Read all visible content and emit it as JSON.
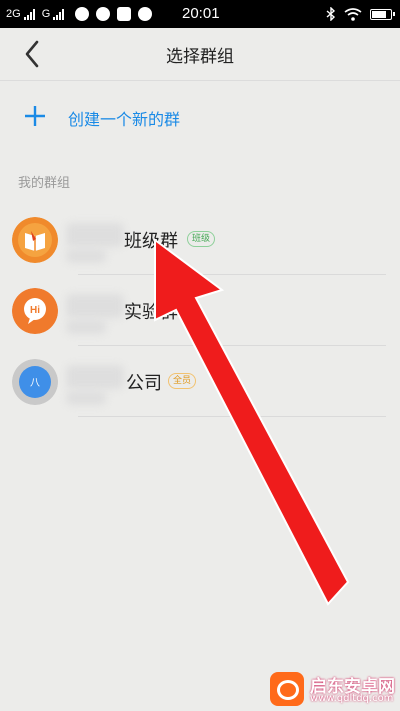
{
  "status_bar": {
    "network_1": "2G",
    "network_2": "G",
    "time": "20:01"
  },
  "nav": {
    "title": "选择群组",
    "back_icon": "chevron-left-icon"
  },
  "create_group": {
    "label": "创建一个新的群",
    "icon": "plus-icon"
  },
  "section": {
    "my_groups": "我的群组"
  },
  "groups": [
    {
      "name_visible": "班级群",
      "tag": "班级",
      "avatar_color": "#f08a2c"
    },
    {
      "name_visible": "实验群",
      "tag": "",
      "avatar_color": "#f07a2c",
      "avatar_text": "Hi"
    },
    {
      "name_visible": "公司",
      "tag": "全员",
      "avatar_color": "#3f8fe8",
      "avatar_text": "八"
    }
  ],
  "colors": {
    "accent": "#1a8ae6",
    "background": "#ececea",
    "arrow": "#ef1c1c"
  },
  "watermark": {
    "text": "启东安卓网",
    "url": "www.qdltdq.com"
  }
}
